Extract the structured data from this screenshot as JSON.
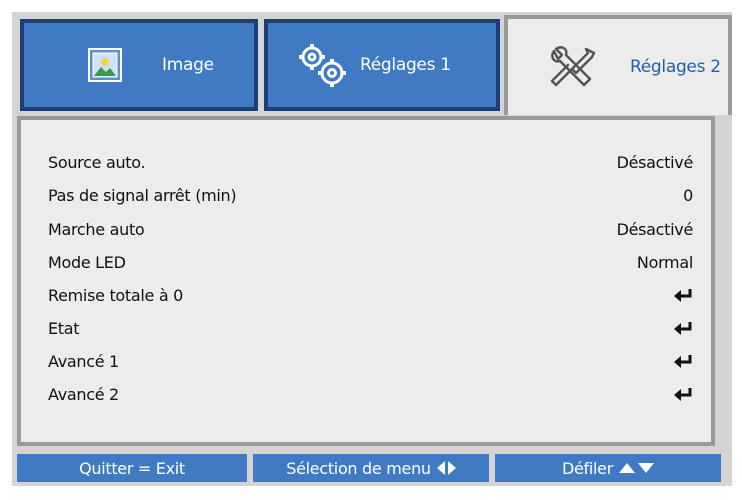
{
  "tabs": [
    {
      "label": "Image",
      "icon": "image-icon",
      "active": false
    },
    {
      "label": "Réglages 1",
      "icon": "gears-icon",
      "active": false
    },
    {
      "label": "Réglages 2",
      "icon": "tools-icon",
      "active": true
    }
  ],
  "menu": {
    "items": [
      {
        "label": "Source auto.",
        "value": "Désactivé"
      },
      {
        "label": "Pas de signal arrêt (min)",
        "value": "0"
      },
      {
        "label": "Marche auto",
        "value": "Désactivé"
      },
      {
        "label": "Mode LED",
        "value": "Normal"
      },
      {
        "label": "Remise totale à 0",
        "value": "enter-icon"
      },
      {
        "label": "Etat",
        "value": "enter-icon"
      },
      {
        "label": "Avancé 1",
        "value": "enter-icon"
      },
      {
        "label": "Avancé 2",
        "value": "enter-icon"
      }
    ]
  },
  "footer": {
    "exit_label": "Quitter = Exit",
    "select_label": "Sélection de menu",
    "scroll_label": "Défiler"
  },
  "colors": {
    "tab_blue": "#3f7ac2",
    "active_tab_text": "#1d5fb0",
    "panel_bg": "#ececec",
    "frame_bg": "#d4d4d4"
  }
}
